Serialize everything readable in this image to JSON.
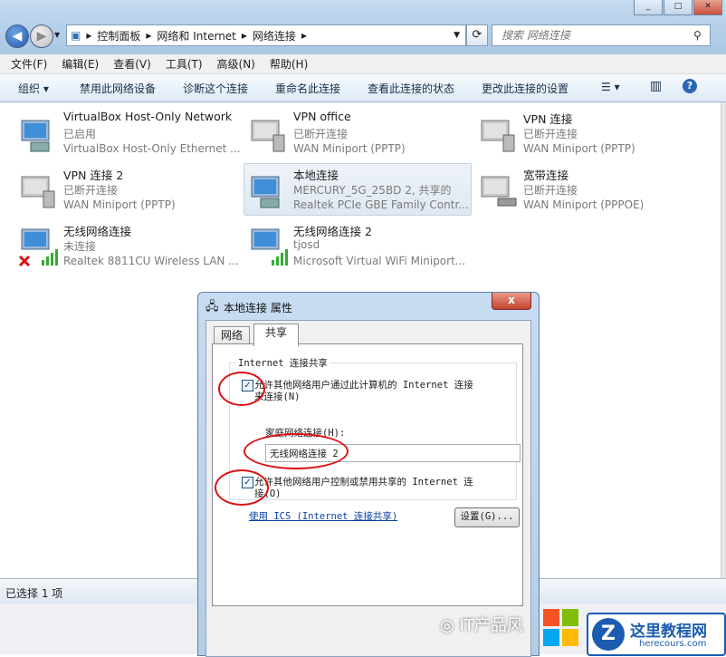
{
  "address": {
    "crumbs": [
      "控制面板",
      "网络和 Internet",
      "网络连接"
    ],
    "search_placeholder": "搜索 网络连接"
  },
  "menu": [
    "文件(F)",
    "编辑(E)",
    "查看(V)",
    "工具(T)",
    "高级(N)",
    "帮助(H)"
  ],
  "commands": [
    "组织",
    "禁用此网络设备",
    "诊断这个连接",
    "重命名此连接",
    "查看此连接的状态",
    "更改此连接的设置"
  ],
  "connections": [
    {
      "name": "VirtualBox Host-Only Network",
      "status": "已启用",
      "device": "VirtualBox Host-Only Ethernet ..."
    },
    {
      "name": "VPN office",
      "status": "已断开连接",
      "device": "WAN Miniport (PPTP)"
    },
    {
      "name": "VPN 连接",
      "status": "已断开连接",
      "device": "WAN Miniport (PPTP)"
    },
    {
      "name": "VPN 连接 2",
      "status": "已断开连接",
      "device": "WAN Miniport (PPTP)"
    },
    {
      "name": "本地连接",
      "status": "MERCURY_5G_25BD  2, 共享的",
      "device": "Realtek PCIe GBE Family Contr..."
    },
    {
      "name": "宽带连接",
      "status": "已断开连接",
      "device": "WAN Miniport (PPPOE)"
    },
    {
      "name": "无线网络连接",
      "status": "未连接",
      "device": "Realtek 8811CU Wireless LAN ..."
    },
    {
      "name": "无线网络连接 2",
      "status": "tjosd",
      "device": "Microsoft Virtual WiFi Miniport..."
    }
  ],
  "status_bar": "已选择 1 项",
  "dialog": {
    "title": "本地连接 属性",
    "tabs": [
      "网络",
      "共享"
    ],
    "group_title": "Internet 连接共享",
    "allow_share_line1": "允许其他网络用户通过此计算机的 Internet 连接",
    "allow_share_line2": "来连接(N)",
    "allow_share_checked": true,
    "home_label": "家庭网络连接(H):",
    "home_value": "无线网络连接 2",
    "allow_control_line1": "允许其他网络用户控制或禁用共享的 Internet 连",
    "allow_control_line2": "接(O)",
    "allow_control_checked": true,
    "ics_link": "使用 ICS (Internet 连接共享)",
    "settings_button": "设置(G)...",
    "close_glyph": "x"
  },
  "watermark": {
    "wechat_text": "IT产品风",
    "brand": "这里教程网",
    "url": "herecours.com"
  }
}
